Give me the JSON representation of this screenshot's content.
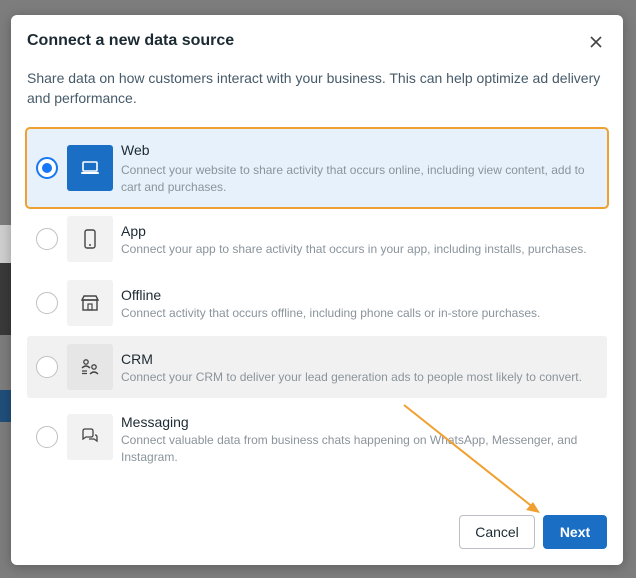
{
  "dialog": {
    "title": "Connect a new data source",
    "description": "Share data on how customers interact with your business. This can help optimize ad delivery and performance."
  },
  "options": [
    {
      "title": "Web",
      "subtitle": "Connect your website to share activity that occurs online, including view content, add to cart and purchases.",
      "selected": true,
      "icon": "laptop-icon"
    },
    {
      "title": "App",
      "subtitle": "Connect your app to share activity that occurs in your app, including installs, purchases.",
      "selected": false,
      "icon": "mobile-phone-icon"
    },
    {
      "title": "Offline",
      "subtitle": "Connect activity that occurs offline, including phone calls or in-store purchases.",
      "selected": false,
      "icon": "store-icon"
    },
    {
      "title": "CRM",
      "subtitle": "Connect your CRM to deliver your lead generation ads to people most likely to convert.",
      "selected": false,
      "icon": "people-sync-icon"
    },
    {
      "title": "Messaging",
      "subtitle": "Connect valuable data from business chats happening on WhatsApp, Messenger, and Instagram.",
      "selected": false,
      "icon": "chat-bubbles-icon"
    }
  ],
  "footer": {
    "cancel_label": "Cancel",
    "next_label": "Next"
  },
  "colors": {
    "accent": "#1a6fc4",
    "highlight_outline": "#f0a030",
    "selected_bg": "#e7f1fb"
  }
}
